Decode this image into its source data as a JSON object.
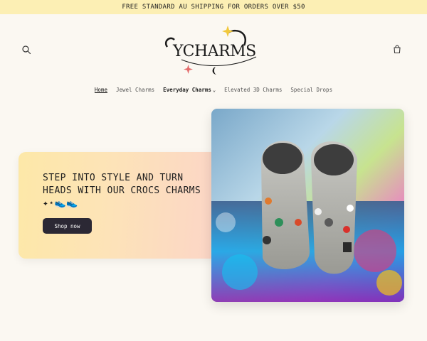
{
  "announcement": {
    "text": "FREE STANDARD AU SHIPPING FOR ORDERS OVER $50"
  },
  "header": {
    "logo_text": "YCHARMS",
    "search_icon": "search-icon",
    "cart_icon": "cart-icon"
  },
  "nav": {
    "items": [
      {
        "label": "Home"
      },
      {
        "label": "Jewel Charms"
      },
      {
        "label": "Everyday Charms"
      },
      {
        "label": "Elevated 3D Charms"
      },
      {
        "label": "Special Drops"
      }
    ]
  },
  "hero": {
    "heading": "STEP INTO STYLE AND TURN HEADS WITH OUR CROCS CHARMS ✦⋆👟👟",
    "button_label": "Shop now"
  },
  "colors": {
    "announcement_bg": "#fcefb4",
    "page_bg": "#fbf8f2",
    "button_bg": "#2b2834"
  }
}
